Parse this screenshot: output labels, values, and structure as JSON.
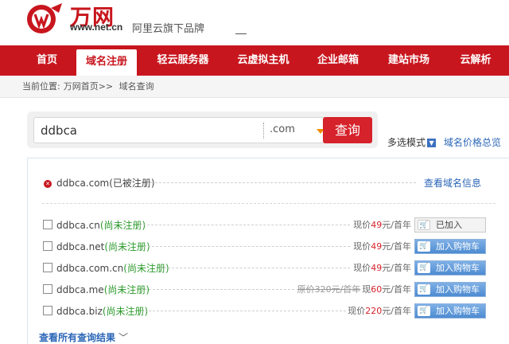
{
  "header": {
    "brand_name": "万网",
    "brand_url": "www.net.cn",
    "tagline": "阿里云旗下品牌",
    "logo_icon": "wanwang-logo-icon",
    "brand_color": "#c8161e"
  },
  "nav": {
    "items": [
      {
        "label": "首页",
        "active": false
      },
      {
        "label": "域名注册",
        "active": true
      },
      {
        "label": "轻云服务器",
        "active": false
      },
      {
        "label": "云虚拟主机",
        "active": false
      },
      {
        "label": "企业邮箱",
        "active": false
      },
      {
        "label": "建站市场",
        "active": false
      },
      {
        "label": "云解析",
        "active": false
      }
    ]
  },
  "breadcrumb": {
    "prefix": "当前位置:",
    "home": "万网首页>>",
    "current": "域名查询"
  },
  "search": {
    "value": "ddbca",
    "suffix": ".com",
    "button": "查询",
    "multi_mode": "多选模式",
    "price_overview": "域名价格总览"
  },
  "results": {
    "registered": {
      "domain": "ddbca.com(已被注册)",
      "action": "查看域名信息"
    },
    "rows": [
      {
        "domain": "ddbca.cn",
        "status": "(尚未注册)",
        "orig_price": "",
        "price_prefix": "现价",
        "price": "49",
        "unit": "元/首年",
        "button": "已加入",
        "added": true
      },
      {
        "domain": "ddbca.net",
        "status": "(尚未注册)",
        "orig_price": "",
        "price_prefix": "现价",
        "price": "49",
        "unit": "元/首年",
        "button": "加入购物车",
        "added": false
      },
      {
        "domain": "ddbca.com.cn",
        "status": "(尚未注册)",
        "orig_price": "",
        "price_prefix": "现价",
        "price": "49",
        "unit": "元/首年",
        "button": "加入购物车",
        "added": false
      },
      {
        "domain": "ddbca.me",
        "status": "(尚未注册)",
        "orig_price": "原价320元/首年",
        "price_prefix": "现",
        "price": "60",
        "unit": "元/首年",
        "button": "加入购物车",
        "added": false
      },
      {
        "domain": "ddbca.biz",
        "status": "(尚未注册)",
        "orig_price": "",
        "price_prefix": "现价",
        "price": "220",
        "unit": "元/首年",
        "button": "加入购物车",
        "added": false
      }
    ],
    "view_all": "查看所有查询结果"
  }
}
